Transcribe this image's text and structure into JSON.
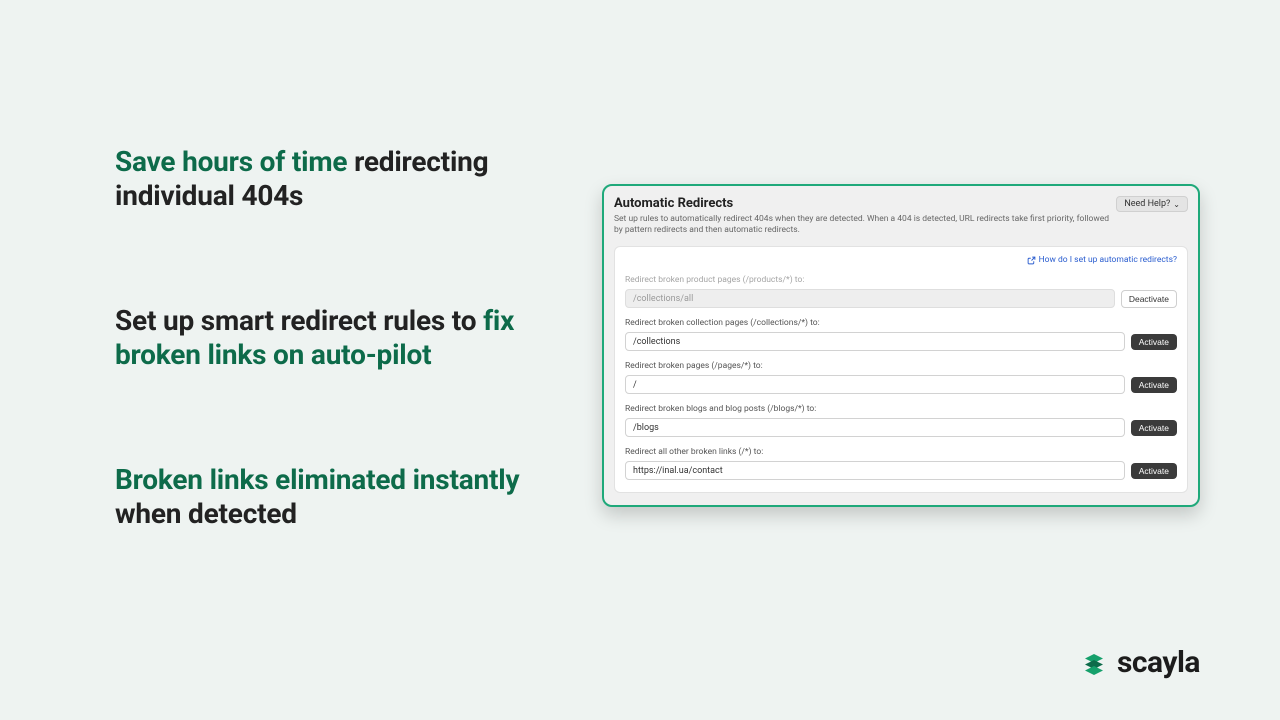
{
  "marketing": {
    "b1_highlight": "Save hours of time",
    "b1_rest": " redirecting individual 404s",
    "b2_lead": "Set up smart redirect rules to ",
    "b2_highlight": "fix broken links on auto-pilot",
    "b3_highlight": "Broken links eliminated instantly",
    "b3_rest": " when detected"
  },
  "card": {
    "title": "Automatic Redirects",
    "subtitle": "Set up rules to automatically redirect 404s when they are detected. When a 404 is detected, URL redirects take first priority, followed by pattern redirects and then automatic redirects.",
    "help_button": "Need Help?",
    "help_link": "How do I set up automatic redirects?"
  },
  "rules": {
    "r1": {
      "label": "Redirect broken product pages (/products/*) to:",
      "value": "/collections/all",
      "action": "Deactivate"
    },
    "r2": {
      "label": "Redirect broken collection pages (/collections/*) to:",
      "value": "/collections",
      "action": "Activate"
    },
    "r3": {
      "label": "Redirect broken pages (/pages/*) to:",
      "value": "/",
      "action": "Activate"
    },
    "r4": {
      "label": "Redirect broken blogs and blog posts (/blogs/*) to:",
      "value": "/blogs",
      "action": "Activate"
    },
    "r5": {
      "label": "Redirect all other broken links (/*) to:",
      "value": "https://inal.ua/contact",
      "action": "Activate"
    }
  },
  "brand": {
    "name": "scayla"
  }
}
